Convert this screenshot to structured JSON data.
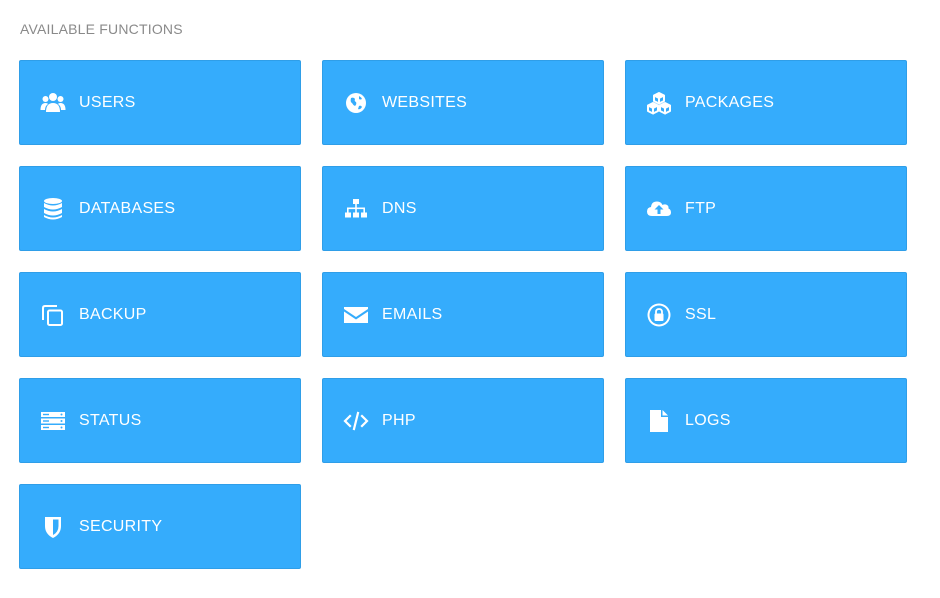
{
  "section": {
    "title": "AVAILABLE FUNCTIONS"
  },
  "functions": [
    {
      "label": "USERS",
      "icon": "users-icon"
    },
    {
      "label": "WEBSITES",
      "icon": "globe-icon"
    },
    {
      "label": "PACKAGES",
      "icon": "cubes-icon"
    },
    {
      "label": "DATABASES",
      "icon": "database-icon"
    },
    {
      "label": "DNS",
      "icon": "sitemap-icon"
    },
    {
      "label": "FTP",
      "icon": "cloud-upload-icon"
    },
    {
      "label": "BACKUP",
      "icon": "copy-icon"
    },
    {
      "label": "EMAILS",
      "icon": "envelope-icon"
    },
    {
      "label": "SSL",
      "icon": "lock-icon"
    },
    {
      "label": "STATUS",
      "icon": "server-icon"
    },
    {
      "label": "PHP",
      "icon": "code-icon"
    },
    {
      "label": "LOGS",
      "icon": "file-icon"
    },
    {
      "label": "SECURITY",
      "icon": "shield-icon"
    }
  ],
  "colors": {
    "tile_background": "#35acfc",
    "tile_border": "#2f9ee8",
    "tile_text": "#ffffff",
    "section_title": "#8a8a8a"
  }
}
